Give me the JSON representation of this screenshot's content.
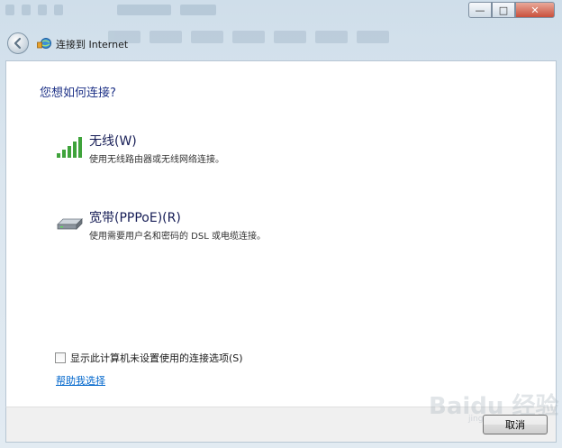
{
  "window": {
    "title": "连接到 Internet",
    "controls": {
      "minimize": "—",
      "maximize": "□",
      "close": "✕"
    }
  },
  "main": {
    "heading": "您想如何连接?",
    "options": [
      {
        "name": "无线(W)",
        "description": "使用无线路由器或无线网络连接。",
        "icon": "wireless-signal-icon"
      },
      {
        "name": "宽带(PPPoE)(R)",
        "description": "使用需要用户名和密码的 DSL 或电缆连接。",
        "icon": "broadband-modem-icon"
      }
    ],
    "show_unconfigured_checkbox": {
      "label": "显示此计算机未设置使用的连接选项(S)",
      "checked": false
    },
    "help_link": "帮助我选择"
  },
  "footer": {
    "cancel_label": "取消"
  },
  "watermark": {
    "text": "Baidu 经验",
    "sub": "jingyan.baidu.com"
  },
  "colors": {
    "heading": "#1e3287",
    "link": "#0066cc",
    "signal_green": "#3fa33b"
  }
}
